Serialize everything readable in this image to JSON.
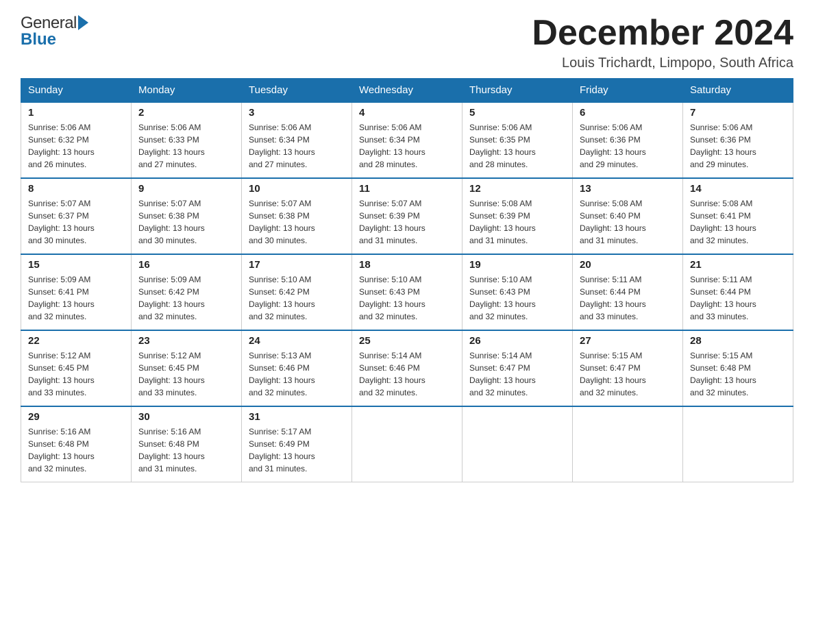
{
  "header": {
    "month_title": "December 2024",
    "location": "Louis Trichardt, Limpopo, South Africa",
    "logo_general": "General",
    "logo_blue": "Blue"
  },
  "weekdays": [
    "Sunday",
    "Monday",
    "Tuesday",
    "Wednesday",
    "Thursday",
    "Friday",
    "Saturday"
  ],
  "weeks": [
    [
      {
        "day": "1",
        "sunrise": "5:06 AM",
        "sunset": "6:32 PM",
        "daylight": "13 hours and 26 minutes."
      },
      {
        "day": "2",
        "sunrise": "5:06 AM",
        "sunset": "6:33 PM",
        "daylight": "13 hours and 27 minutes."
      },
      {
        "day": "3",
        "sunrise": "5:06 AM",
        "sunset": "6:34 PM",
        "daylight": "13 hours and 27 minutes."
      },
      {
        "day": "4",
        "sunrise": "5:06 AM",
        "sunset": "6:34 PM",
        "daylight": "13 hours and 28 minutes."
      },
      {
        "day": "5",
        "sunrise": "5:06 AM",
        "sunset": "6:35 PM",
        "daylight": "13 hours and 28 minutes."
      },
      {
        "day": "6",
        "sunrise": "5:06 AM",
        "sunset": "6:36 PM",
        "daylight": "13 hours and 29 minutes."
      },
      {
        "day": "7",
        "sunrise": "5:06 AM",
        "sunset": "6:36 PM",
        "daylight": "13 hours and 29 minutes."
      }
    ],
    [
      {
        "day": "8",
        "sunrise": "5:07 AM",
        "sunset": "6:37 PM",
        "daylight": "13 hours and 30 minutes."
      },
      {
        "day": "9",
        "sunrise": "5:07 AM",
        "sunset": "6:38 PM",
        "daylight": "13 hours and 30 minutes."
      },
      {
        "day": "10",
        "sunrise": "5:07 AM",
        "sunset": "6:38 PM",
        "daylight": "13 hours and 30 minutes."
      },
      {
        "day": "11",
        "sunrise": "5:07 AM",
        "sunset": "6:39 PM",
        "daylight": "13 hours and 31 minutes."
      },
      {
        "day": "12",
        "sunrise": "5:08 AM",
        "sunset": "6:39 PM",
        "daylight": "13 hours and 31 minutes."
      },
      {
        "day": "13",
        "sunrise": "5:08 AM",
        "sunset": "6:40 PM",
        "daylight": "13 hours and 31 minutes."
      },
      {
        "day": "14",
        "sunrise": "5:08 AM",
        "sunset": "6:41 PM",
        "daylight": "13 hours and 32 minutes."
      }
    ],
    [
      {
        "day": "15",
        "sunrise": "5:09 AM",
        "sunset": "6:41 PM",
        "daylight": "13 hours and 32 minutes."
      },
      {
        "day": "16",
        "sunrise": "5:09 AM",
        "sunset": "6:42 PM",
        "daylight": "13 hours and 32 minutes."
      },
      {
        "day": "17",
        "sunrise": "5:10 AM",
        "sunset": "6:42 PM",
        "daylight": "13 hours and 32 minutes."
      },
      {
        "day": "18",
        "sunrise": "5:10 AM",
        "sunset": "6:43 PM",
        "daylight": "13 hours and 32 minutes."
      },
      {
        "day": "19",
        "sunrise": "5:10 AM",
        "sunset": "6:43 PM",
        "daylight": "13 hours and 32 minutes."
      },
      {
        "day": "20",
        "sunrise": "5:11 AM",
        "sunset": "6:44 PM",
        "daylight": "13 hours and 33 minutes."
      },
      {
        "day": "21",
        "sunrise": "5:11 AM",
        "sunset": "6:44 PM",
        "daylight": "13 hours and 33 minutes."
      }
    ],
    [
      {
        "day": "22",
        "sunrise": "5:12 AM",
        "sunset": "6:45 PM",
        "daylight": "13 hours and 33 minutes."
      },
      {
        "day": "23",
        "sunrise": "5:12 AM",
        "sunset": "6:45 PM",
        "daylight": "13 hours and 33 minutes."
      },
      {
        "day": "24",
        "sunrise": "5:13 AM",
        "sunset": "6:46 PM",
        "daylight": "13 hours and 32 minutes."
      },
      {
        "day": "25",
        "sunrise": "5:14 AM",
        "sunset": "6:46 PM",
        "daylight": "13 hours and 32 minutes."
      },
      {
        "day": "26",
        "sunrise": "5:14 AM",
        "sunset": "6:47 PM",
        "daylight": "13 hours and 32 minutes."
      },
      {
        "day": "27",
        "sunrise": "5:15 AM",
        "sunset": "6:47 PM",
        "daylight": "13 hours and 32 minutes."
      },
      {
        "day": "28",
        "sunrise": "5:15 AM",
        "sunset": "6:48 PM",
        "daylight": "13 hours and 32 minutes."
      }
    ],
    [
      {
        "day": "29",
        "sunrise": "5:16 AM",
        "sunset": "6:48 PM",
        "daylight": "13 hours and 32 minutes."
      },
      {
        "day": "30",
        "sunrise": "5:16 AM",
        "sunset": "6:48 PM",
        "daylight": "13 hours and 31 minutes."
      },
      {
        "day": "31",
        "sunrise": "5:17 AM",
        "sunset": "6:49 PM",
        "daylight": "13 hours and 31 minutes."
      },
      null,
      null,
      null,
      null
    ]
  ],
  "labels": {
    "sunrise": "Sunrise:",
    "sunset": "Sunset:",
    "daylight": "Daylight:"
  }
}
